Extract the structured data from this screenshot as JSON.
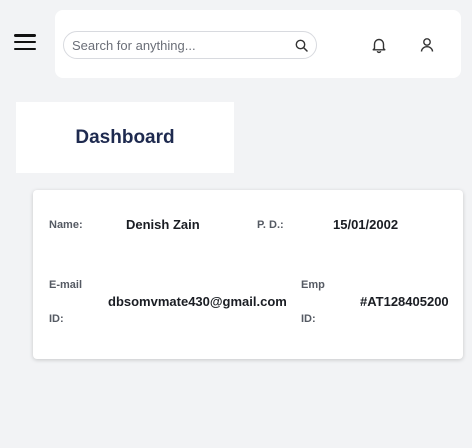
{
  "search": {
    "placeholder": "Search for anything..."
  },
  "icons": {
    "menu": "hamburger-menu-icon",
    "search": "search-icon",
    "bell": "bell-icon",
    "user": "user-icon"
  },
  "page": {
    "title": "Dashboard"
  },
  "profile": {
    "name_label": "Name:",
    "name_value": "Denish Zain",
    "pd_label": "P. D.:",
    "pd_value": "15/01/2002",
    "email_label_1": "E-mail",
    "email_label_2": "ID:",
    "email_value": "dbsomvmate430@gmail.com",
    "emp_label_1": "Emp",
    "emp_label_2": "ID:",
    "emp_value": "#AT128405200"
  }
}
